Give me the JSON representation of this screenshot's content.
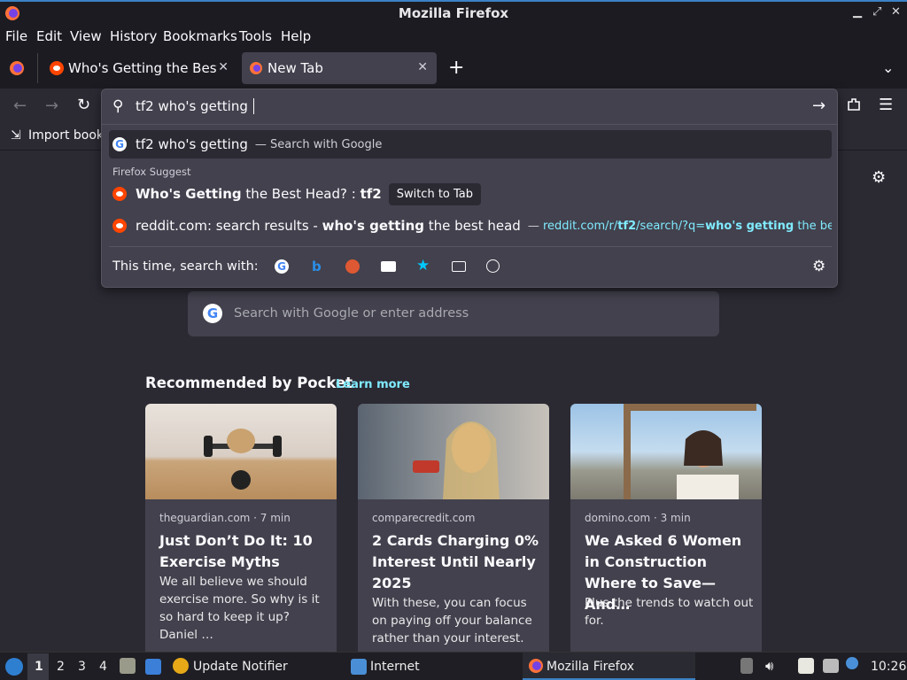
{
  "window": {
    "title": "Mozilla Firefox"
  },
  "menu": [
    "File",
    "Edit",
    "View",
    "History",
    "Bookmarks",
    "Tools",
    "Help"
  ],
  "tabs": [
    {
      "label": "Who's Getting the Best H"
    },
    {
      "label": "New Tab"
    }
  ],
  "urlbar": {
    "value": "tf2 who's getting "
  },
  "bookmarks": {
    "import_label": "Import book"
  },
  "popup": {
    "first": {
      "label": "tf2 who's getting",
      "hint": "Search with Google"
    },
    "group_label": "Firefox Suggest",
    "suggest1": {
      "bold1": "Who's Getting",
      "mid": " the Best Head? : ",
      "bold2": "tf2",
      "action": "Switch to Tab"
    },
    "suggest2": {
      "pre": "reddit.com: search results - ",
      "bold": "who's getting",
      "post": " the best head",
      "url_a": "reddit.com/r/",
      "url_b": "tf2",
      "url_c": "/search/?q=",
      "url_d": "who's getting",
      "url_e": " the best head"
    },
    "search_with": "This time, search with:"
  },
  "search": {
    "placeholder": "Search with Google or enter address"
  },
  "pocket": {
    "heading": "Recommended by Pocket",
    "learn_more": "Learn more",
    "cards": [
      {
        "source": "theguardian.com · 7 min",
        "title": "Just Don’t Do It: 10 Exercise Myths",
        "excerpt": "We all believe we should exercise more. So why is it so hard to keep it up? Daniel …"
      },
      {
        "source": "comparecredit.com",
        "title": "2 Cards Charging 0% Interest Until Nearly 2025",
        "excerpt": "With these, you can focus on paying off your balance rather than your interest."
      },
      {
        "source": "domino.com · 3 min",
        "title": "We Asked 6 Women in Construction Where to Save—And…",
        "excerpt": "Plus the trends to watch out for."
      }
    ]
  },
  "taskbar": {
    "workspaces": [
      "1",
      "2",
      "3",
      "4"
    ],
    "apps": [
      "Update Notifier",
      "Internet",
      "Mozilla Firefox"
    ],
    "clock": "10:26"
  }
}
